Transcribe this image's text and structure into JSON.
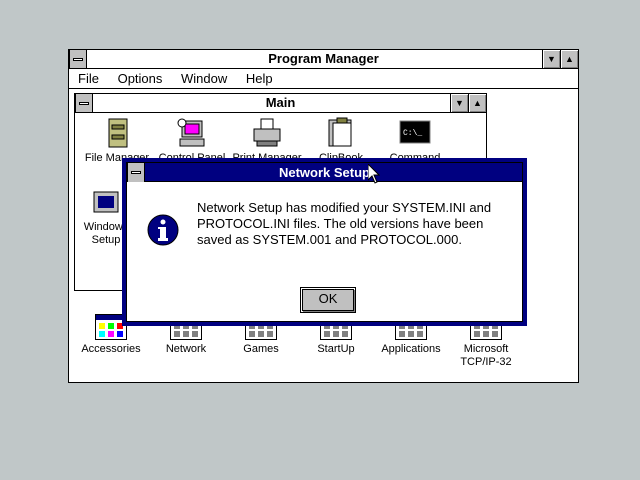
{
  "program_manager": {
    "title": "Program Manager",
    "menu": [
      "File",
      "Options",
      "Window",
      "Help"
    ]
  },
  "main_group": {
    "title": "Main",
    "icons": [
      "File Manager",
      "Control Panel",
      "Print Manager",
      "ClipBook",
      "Command",
      "Windows",
      "Setup"
    ]
  },
  "groups": [
    {
      "label": "Accessories"
    },
    {
      "label": "Network"
    },
    {
      "label": "Games"
    },
    {
      "label": "StartUp"
    },
    {
      "label": "Applications"
    },
    {
      "label": "Microsoft\nTCP/IP-32"
    }
  ],
  "dialog": {
    "title": "Network Setup",
    "message": "Network Setup has modified your SYSTEM.INI and PROTOCOL.INI files. The old versions have been saved as SYSTEM.001 and PROTOCOL.000.",
    "ok_label": "OK",
    "icon": "information-icon"
  },
  "colors": {
    "desktop": "#c0c7c8",
    "active_title": "#000080",
    "window": "#ffffff"
  }
}
